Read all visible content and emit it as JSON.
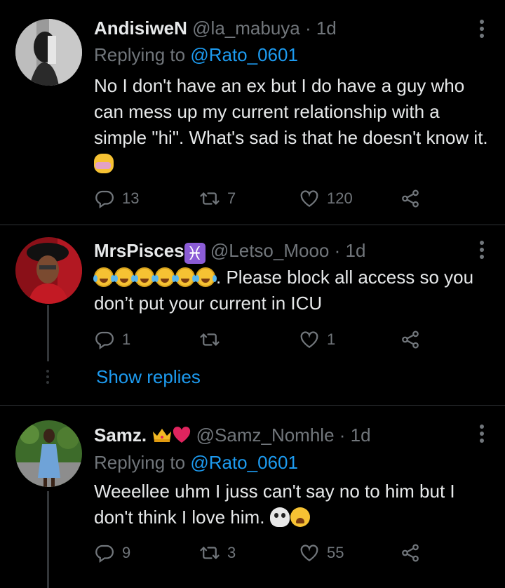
{
  "tweets": [
    {
      "name": "AndisiweN",
      "handle": "@la_mabuya · 1d",
      "replying_prefix": "Replying to ",
      "replying_handle": "@Rato_0601",
      "text": "No I don't have an ex but I do have a guy who can mess up my current relationship with a simple \"hi\". What's sad is that he doesn't know it.",
      "replies": "13",
      "retweets": "7",
      "likes": "120"
    },
    {
      "name": "MrsPisces",
      "handle": "@Letso_Mooo · 1d",
      "text_after_emoji": ". Please block all access so you don’t put your current in ICU",
      "replies": "1",
      "retweets": "",
      "likes": "1",
      "show_replies": "Show replies"
    },
    {
      "name": "Samz.",
      "handle": "@Samz_Nomhle · 1d",
      "replying_prefix": "Replying to ",
      "replying_handle": "@Rato_0601",
      "text": "Weeellee uhm I juss can't say no to him but I don't think I love him.",
      "replies": "9",
      "retweets": "3",
      "likes": "55"
    }
  ],
  "colors": {
    "background": "#000000",
    "text": "#e7e9ea",
    "secondary": "#71767b",
    "link": "#1d9bf0"
  },
  "icons": [
    "reply-icon",
    "retweet-icon",
    "like-icon",
    "share-icon",
    "more-icon"
  ]
}
